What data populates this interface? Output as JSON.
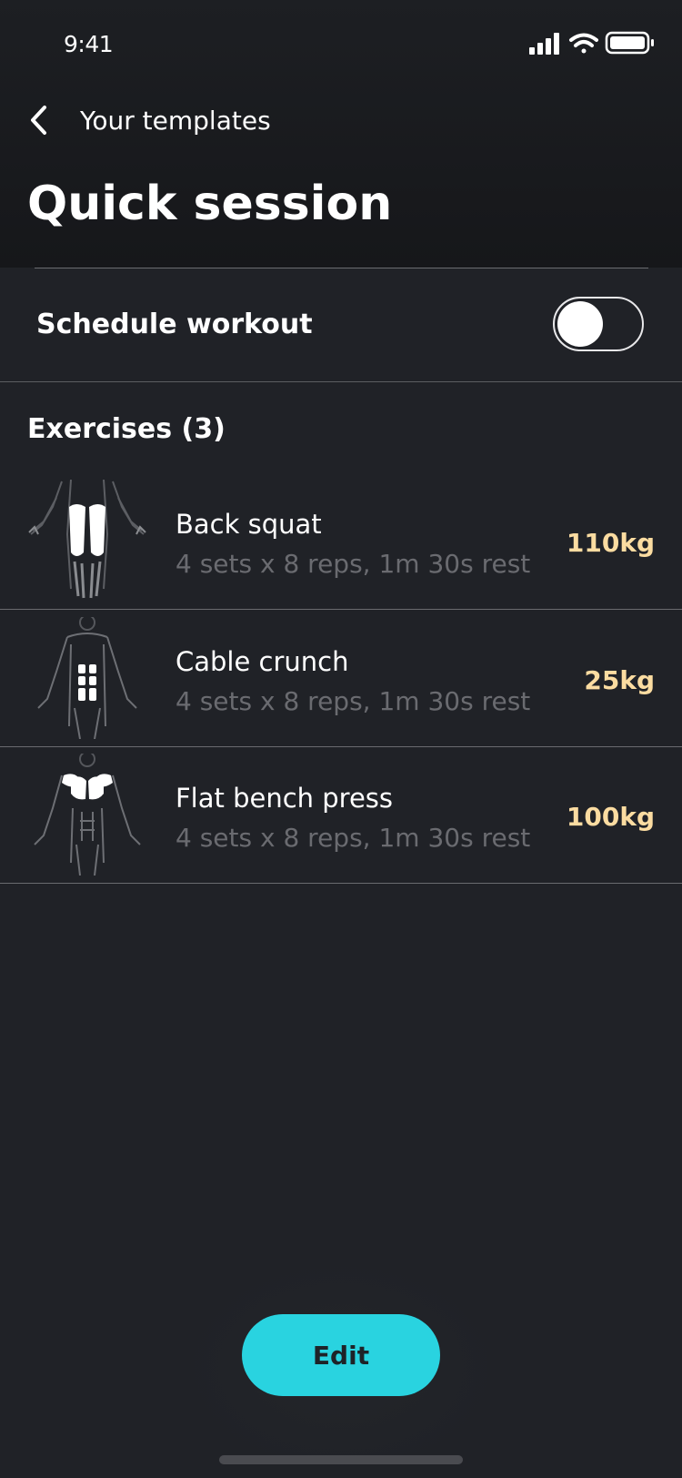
{
  "status_bar": {
    "time": "9:41"
  },
  "nav": {
    "back_label": "Your templates"
  },
  "page": {
    "title": "Quick session"
  },
  "schedule": {
    "label": "Schedule workout",
    "enabled": false
  },
  "exercises_section": {
    "title": "Exercises (3)"
  },
  "exercises": [
    {
      "name": "Back squat",
      "detail": "4 sets x 8 reps, 1m 30s rest",
      "weight": "110kg",
      "muscle_icon": "legs-muscle-icon"
    },
    {
      "name": "Cable crunch",
      "detail": "4 sets x 8 reps, 1m 30s rest",
      "weight": "25kg",
      "muscle_icon": "abs-muscle-icon"
    },
    {
      "name": "Flat bench press",
      "detail": "4 sets x 8 reps, 1m 30s rest",
      "weight": "100kg",
      "muscle_icon": "chest-muscle-icon"
    }
  ],
  "actions": {
    "edit_label": "Edit"
  },
  "colors": {
    "background": "#202227",
    "accent": "#29d3e0",
    "weight": "#fbdca1",
    "muted_text": "#6a6b70"
  }
}
